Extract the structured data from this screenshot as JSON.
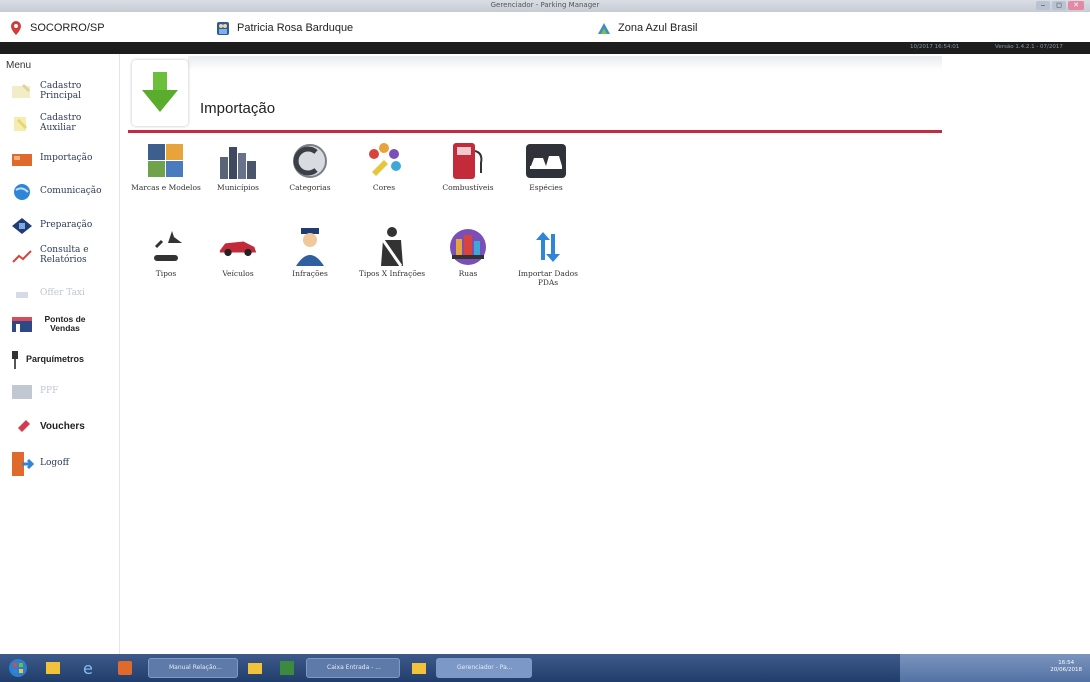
{
  "window": {
    "title": "Gerenciador - Parking Manager",
    "controls": [
      "–",
      "◻",
      "✕"
    ]
  },
  "header": {
    "city": "SOCORRO/SP",
    "user": "Patricia Rosa Barduque",
    "company": "Zona Azul Brasil",
    "session_info": "10/2017 16:54:01",
    "version_info": "Versão 1.4.2.1 - 07/2017"
  },
  "sidebar": {
    "menu_title": "Menu",
    "items": [
      {
        "label": "Cadastro Principal",
        "icon": "pencil-icon",
        "color": "#e0d39a"
      },
      {
        "label": "Cadastro Auxiliar",
        "icon": "pencil-note-icon",
        "color": "#e8d574"
      },
      {
        "label": "Importação",
        "icon": "import-icon",
        "color": "#e06a2c"
      },
      {
        "label": "Comunicação",
        "icon": "globe-icon",
        "color": "#2f86d6"
      },
      {
        "label": "Preparação",
        "icon": "device-icon",
        "color": "#1f3d73"
      },
      {
        "label": "Consulta e Relatórios",
        "icon": "chart-icon",
        "color": "#d8443c"
      },
      {
        "label": "Offer Taxi",
        "icon": "taxi-icon",
        "color": "#d5dbe6"
      },
      {
        "label": "Pontos de Vendas",
        "icon": "store-icon",
        "color": "#2d4a87"
      },
      {
        "label": "Parquímetros",
        "icon": "parking-meter-icon",
        "color": "#333333"
      },
      {
        "label": "PPF",
        "icon": "ppf-icon",
        "color": "#c2c8d2"
      },
      {
        "label": "Vouchers",
        "icon": "voucher-icon",
        "color": "#d4394c"
      },
      {
        "label": "Logoff",
        "icon": "logoff-door-icon",
        "color": "#e06a2c"
      }
    ]
  },
  "main": {
    "title": "Importação",
    "title_icon": "download-arrow-icon",
    "accent_color": "#c32a44",
    "tiles_row1": [
      {
        "label": "Marcas e Modelos",
        "icon": "puzzle-icon"
      },
      {
        "label": "Municípios",
        "icon": "city-icon"
      },
      {
        "label": "Categorias",
        "icon": "categories-icon"
      },
      {
        "label": "Cores",
        "icon": "palette-icon"
      },
      {
        "label": "Combustíveis",
        "icon": "fuel-pump-icon"
      },
      {
        "label": "Espécies",
        "icon": "vehicles-icon"
      }
    ],
    "tiles_row2": [
      {
        "label": "Tipos",
        "icon": "plane-car-icon"
      },
      {
        "label": "Veículos",
        "icon": "car-icon"
      },
      {
        "label": "Infrações",
        "icon": "officer-icon"
      },
      {
        "label": "Tipos X Infrações",
        "icon": "seatbelt-icon"
      },
      {
        "label": "Ruas",
        "icon": "street-icon"
      },
      {
        "label": "Importar Dados PDAs",
        "icon": "transfer-arrows-icon"
      }
    ]
  },
  "taskbar": {
    "items": [
      "Manual Relação...",
      "Caixa Entrada - ...",
      "Gerenciador - Pa..."
    ],
    "clock_time": "16:54",
    "clock_date": "20/06/2018"
  }
}
